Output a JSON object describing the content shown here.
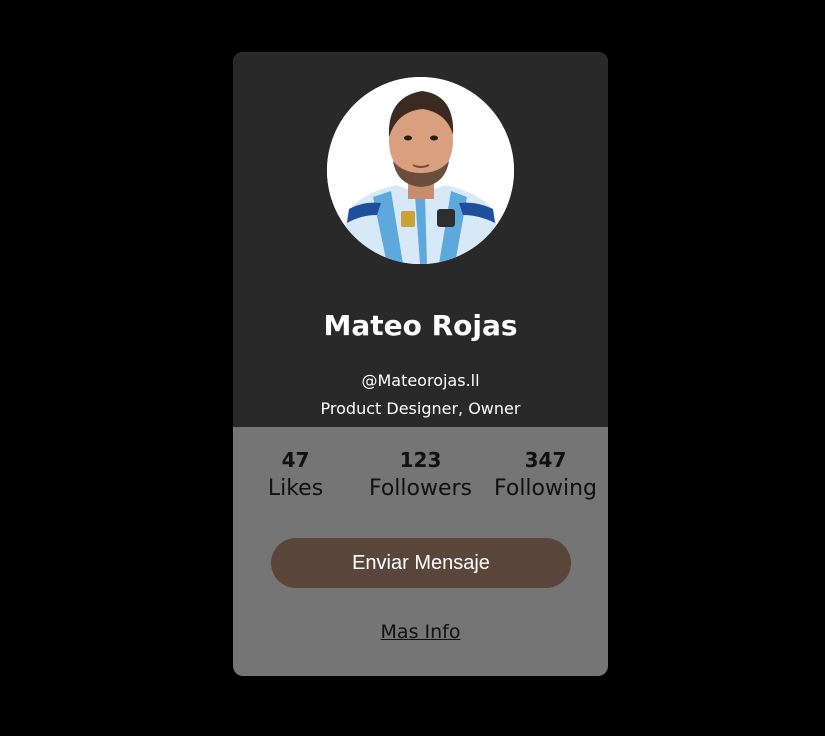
{
  "profile": {
    "name": "Mateo Rojas",
    "handle": "@Mateorojas.ll",
    "role": "Product Designer, Owner",
    "avatar_icon": "profile-photo"
  },
  "stats": [
    {
      "value": "47",
      "label": "Likes"
    },
    {
      "value": "123",
      "label": "Followers"
    },
    {
      "value": "347",
      "label": "Following"
    }
  ],
  "actions": {
    "message_label": "Enviar Mensaje",
    "more_info_label": "Mas Info"
  },
  "colors": {
    "page_background": "#000000",
    "card_top": "#292929",
    "card_bottom": "#757575",
    "button": "#5a453a"
  }
}
